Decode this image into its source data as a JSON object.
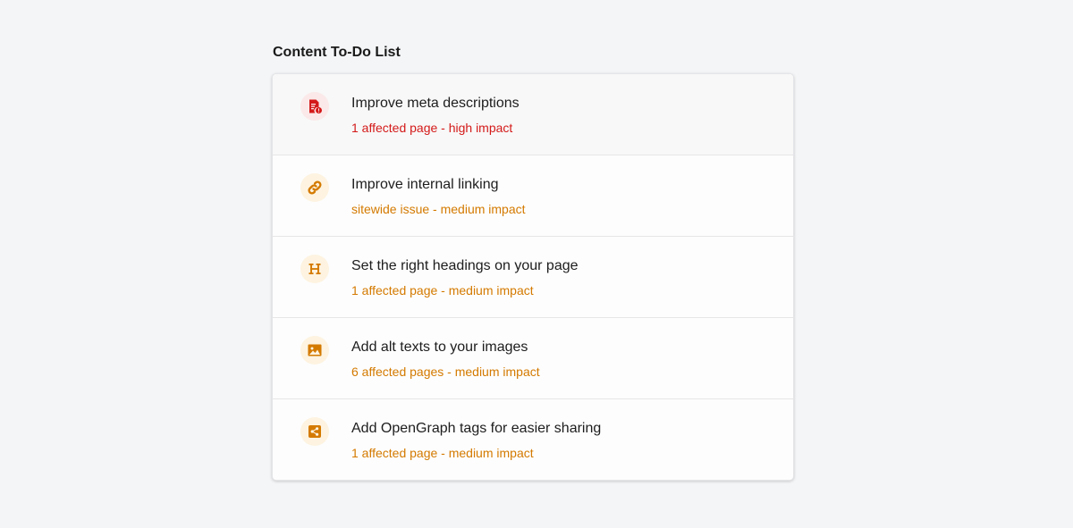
{
  "section": {
    "title": "Content To-Do List"
  },
  "colors": {
    "high": "#d41a1a",
    "high_bg": "#fbe9e9",
    "medium": "#d47a00",
    "medium_bg": "#fdf3e0"
  },
  "items": [
    {
      "title": "Improve meta descriptions",
      "subtitle": "1 affected page - high impact",
      "impact": "high",
      "icon": "document-alert-icon"
    },
    {
      "title": "Improve internal linking",
      "subtitle": "sitewide issue - medium impact",
      "impact": "medium",
      "icon": "link-icon"
    },
    {
      "title": "Set the right headings on your page",
      "subtitle": "1 affected page - medium impact",
      "impact": "medium",
      "icon": "heading-icon"
    },
    {
      "title": "Add alt texts to your images",
      "subtitle": "6 affected pages - medium impact",
      "impact": "medium",
      "icon": "image-icon"
    },
    {
      "title": "Add OpenGraph tags for easier sharing",
      "subtitle": "1 affected page - medium impact",
      "impact": "medium",
      "icon": "share-icon"
    }
  ]
}
